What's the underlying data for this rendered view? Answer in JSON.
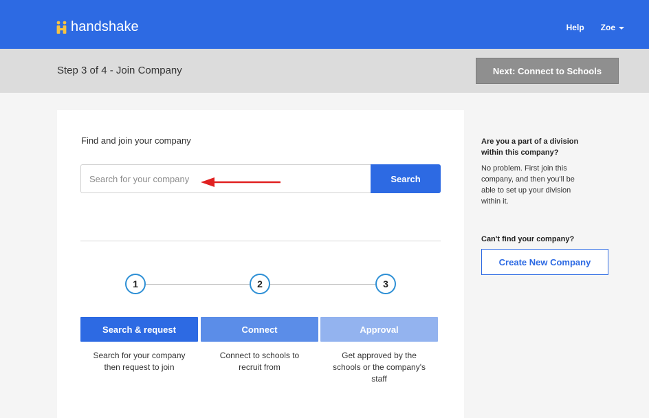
{
  "header": {
    "brand": "handshake",
    "help_label": "Help",
    "user_name": "Zoe",
    "brand_color": "#2d6ae3"
  },
  "stepbar": {
    "title": "Step 3 of 4 - Join Company",
    "next_label": "Next: Connect to Schools"
  },
  "main": {
    "find_label": "Find and join your company",
    "search": {
      "placeholder": "Search for your company",
      "value": "",
      "button_label": "Search"
    },
    "steps": [
      {
        "number": "1",
        "label": "Search & request",
        "desc_lines": [
          "Search for your company",
          "then request to join"
        ],
        "color": "#2d6ae3"
      },
      {
        "number": "2",
        "label": "Connect",
        "desc_lines": [
          "Connect to schools to",
          "recruit from"
        ],
        "color": "#5b8de8"
      },
      {
        "number": "3",
        "label": "Approval",
        "desc_lines": [
          "Get approved by the",
          "schools or the company's",
          "staff"
        ],
        "color": "#93b3ef"
      }
    ]
  },
  "sidebar": {
    "question_lines": [
      "Are you a part of a division",
      "within this company?"
    ],
    "answer_lines": [
      "No problem. First join this",
      "company, and then you'll be",
      "able to set up your division",
      "within it."
    ],
    "cant_find": "Can't find your company?",
    "create_label": "Create New Company"
  },
  "annotation": {
    "arrow_color": "#e02020"
  }
}
